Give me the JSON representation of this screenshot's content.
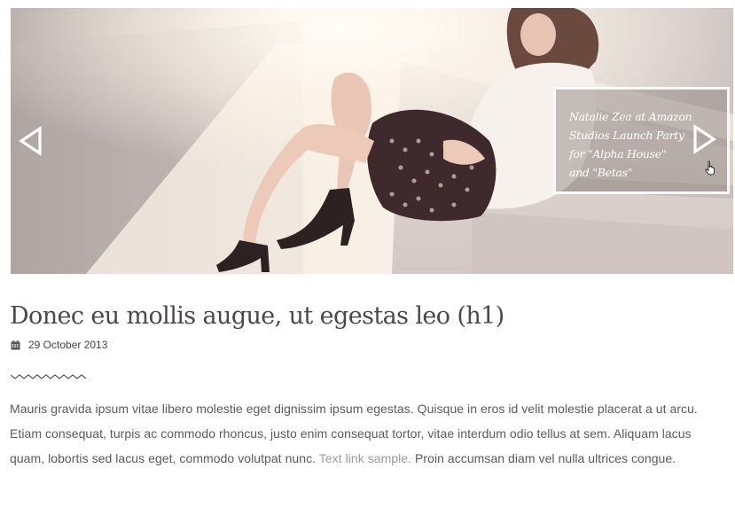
{
  "slider": {
    "caption": "Natalie Zea at Amazon\nStudios Launch Party\nfor \"Alpha House\"\nand \"Betas\"",
    "prev_icon": "triangle-left-outline-icon",
    "next_icon": "triangle-right-outline-icon"
  },
  "post": {
    "title": "Donec eu mollis augue, ut egestas leo (h1)",
    "date": "29 October 2013",
    "date_icon": "calendar-icon",
    "divider_icon": "zigzag-divider",
    "body_before_link": "Mauris gravida ipsum vitae libero molestie eget dignissim ipsum egestas. Quisque in eros id velit molestie placerat a ut arcu. Etiam consequat, turpis ac commodo rhoncus, justo enim consequat tortor, vitae interdum odio tellus at sem. Aliquam lacus quam, lobortis sed lacus eget, commodo volutpat nunc. ",
    "link_text": "Text link sample.",
    "body_after_link": " Proin accumsan diam vel nulla ultrices congue."
  },
  "colors": {
    "title": "#4d4747",
    "body": "#5a5a5a",
    "link": "#9b9b9b",
    "caption_border": "#ffffff"
  }
}
